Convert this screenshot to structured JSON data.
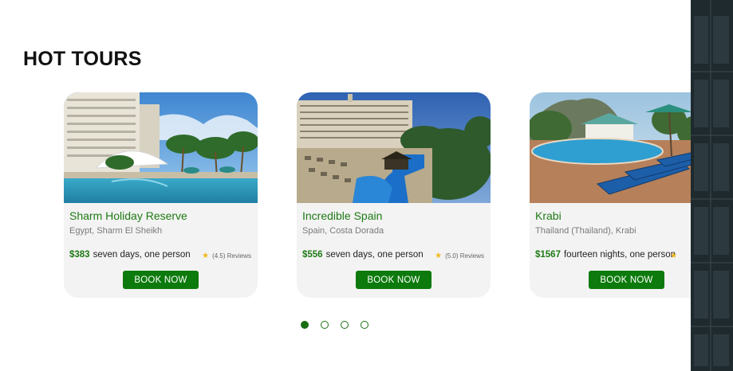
{
  "section": {
    "title": "HOT TOURS"
  },
  "tours": [
    {
      "title": "Sharm Holiday Reserve",
      "location": "Egypt, Sharm El Sheikh",
      "price": "$383",
      "duration": "seven days, one person",
      "rating": "(4.5) Reviews",
      "book_label": "BOOK NOW",
      "image_icon": "resort-pool-photo"
    },
    {
      "title": "Incredible Spain",
      "location": "Spain, Costa Dorada",
      "price": "$556",
      "duration": "seven days, one person",
      "rating": "(5.0) Reviews",
      "book_label": "BOOK NOW",
      "image_icon": "hotel-pool-photo"
    },
    {
      "title": "Krabi",
      "location": "Thailand (Thailand), Krabi",
      "price": "$1567",
      "duration": "fourteen nights, one person",
      "rating": "",
      "book_label": "BOOK NOW",
      "image_icon": "tropical-pool-photo"
    }
  ],
  "pagination": {
    "count": 4,
    "active": 1
  },
  "colors": {
    "accent": "#0c7a0c",
    "title_green": "#1e7a14",
    "card_bg": "#f3f3f3",
    "star": "#f2b91c",
    "side_panel": "#1f2a2e"
  }
}
